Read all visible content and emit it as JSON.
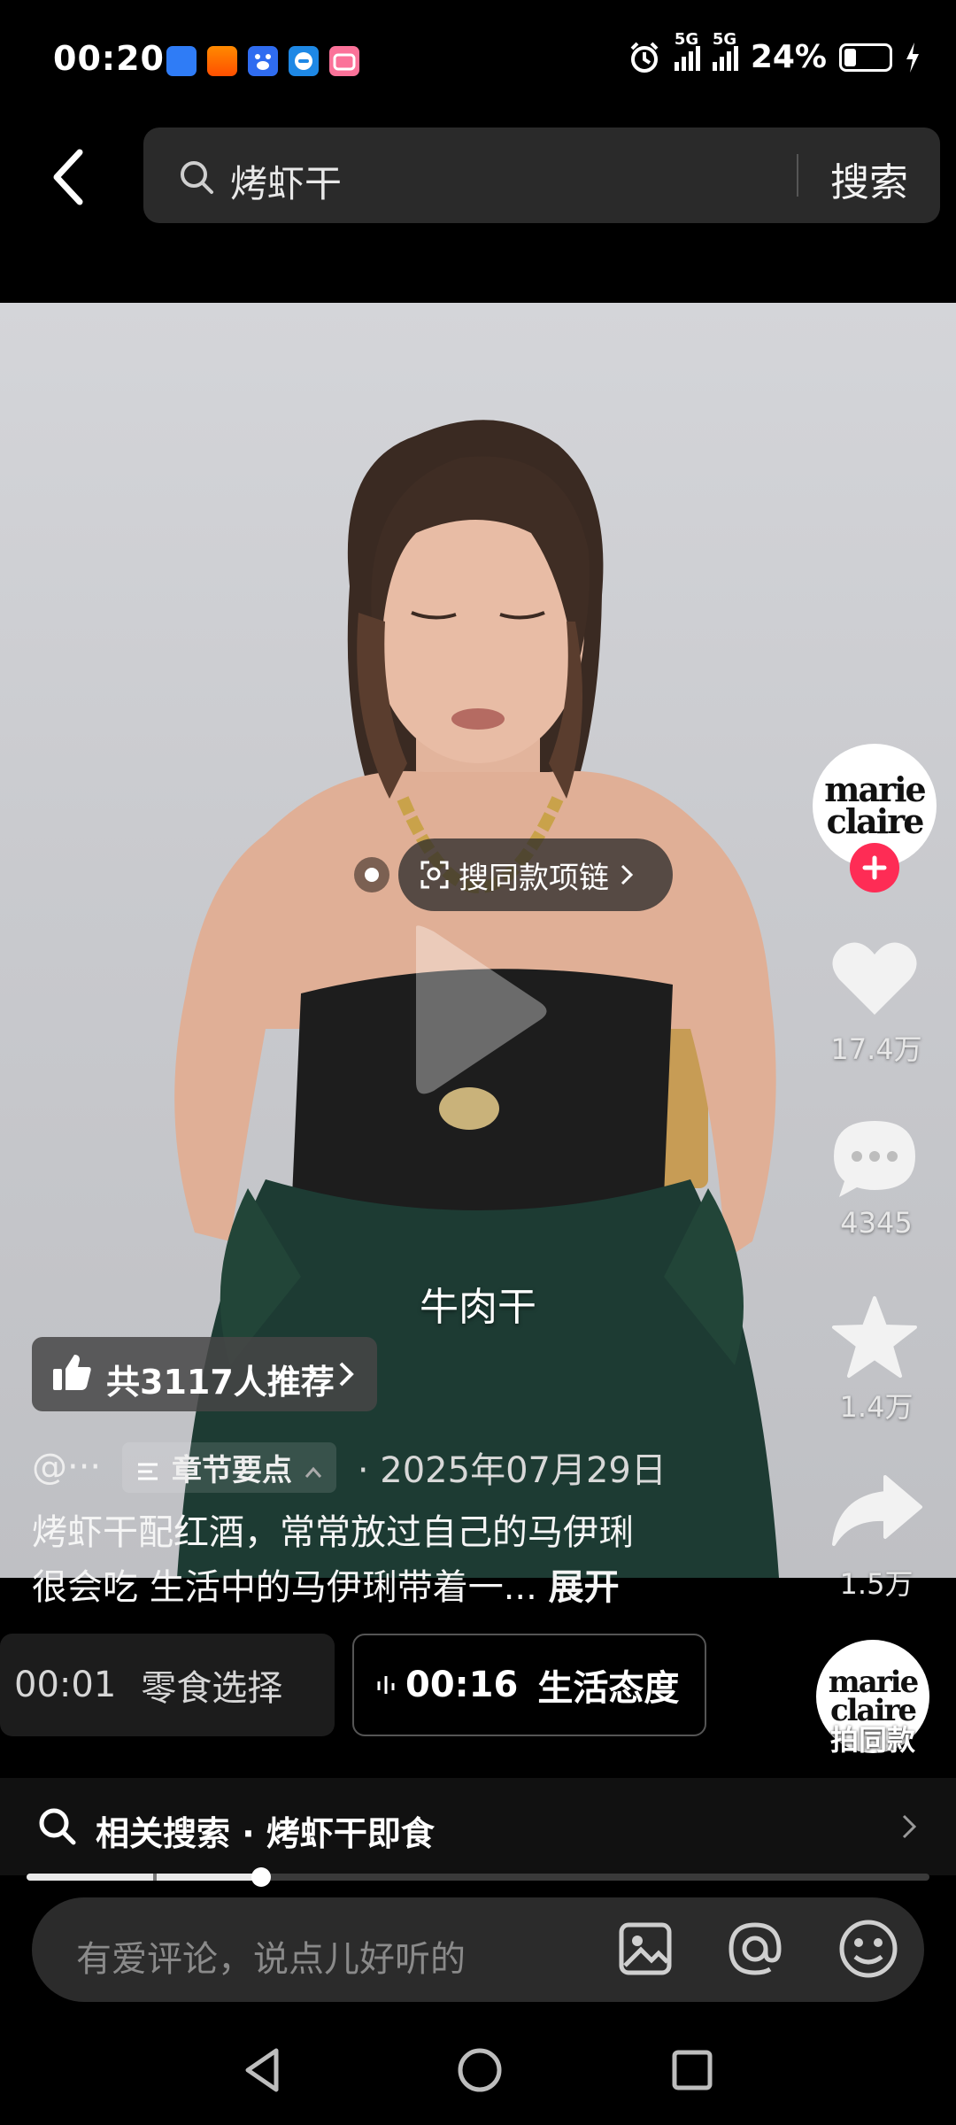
{
  "status_bar": {
    "time": "00:20",
    "network_1": "5G",
    "network_2": "5G",
    "battery": "24%",
    "notification_icons": [
      "message-app-icon",
      "taobao-shangou-icon",
      "baidu-icon",
      "chat-bubble-icon",
      "bilibili-icon"
    ]
  },
  "search": {
    "query": "烤虾干",
    "button_label": "搜索"
  },
  "video": {
    "shop_tag_label": "搜同款项链",
    "subtitle": "牛肉干"
  },
  "right_rail": {
    "author_logo_line1": "marie",
    "author_logo_line2": "claire",
    "like_count": "17.4万",
    "comment_count": "4345",
    "favorite_count": "1.4万",
    "share_count": "1.5万",
    "same_style_label": "拍同款"
  },
  "caption": {
    "recommend": "共3117人推荐",
    "author": "@···",
    "chapter_tag": "章节要点",
    "date": "· 2025年07月29日",
    "description_line1": "烤虾干配红酒，常常放过自己的马伊琍",
    "description_line2": "很会吃 生活中的马伊琍带着一...",
    "expand": "展开"
  },
  "chapters": [
    {
      "time": "00:01",
      "title": "零食选择"
    },
    {
      "time": "00:16",
      "title": "生活态度"
    }
  ],
  "related_search": {
    "label": "相关搜索 · 烤虾干即食"
  },
  "progress": {
    "played_fraction": 0.26,
    "segment_marker_fraction": 0.14
  },
  "comment": {
    "placeholder": "有爱评论，说点儿好听的"
  },
  "colors": {
    "follow_plus": "#fe2c55",
    "background": "#000000"
  }
}
